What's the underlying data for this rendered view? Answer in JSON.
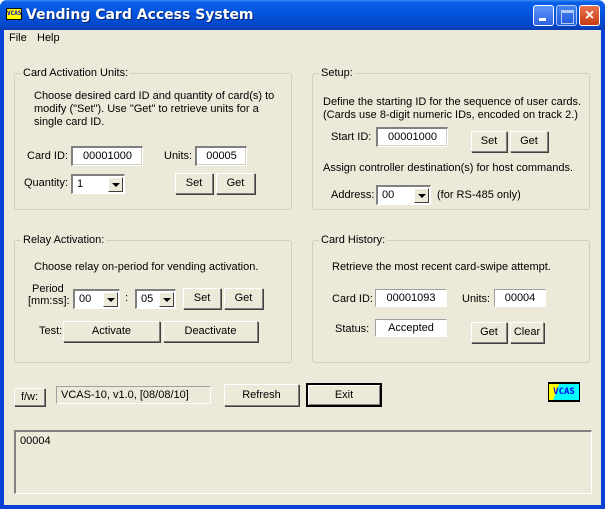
{
  "window": {
    "title": "Vending Card Access System",
    "icon_label": "VCAS",
    "controls": {
      "minimize": "minimize",
      "maximize": "maximize",
      "close": "×"
    }
  },
  "menu": [
    {
      "label": "File"
    },
    {
      "label": "Help"
    }
  ],
  "card_activation": {
    "title": "Card Activation Units:",
    "desc_line1": "Choose desired card ID and quantity of card(s) to",
    "desc_line2": "modify (\"Set\").  Use \"Get\" to retrieve units for a",
    "desc_line3": "single card ID.",
    "card_id_label": "Card ID:",
    "card_id_value": "00001000",
    "units_label": "Units:",
    "units_value": "00005",
    "quantity_label": "Quantity:",
    "quantity_value": "1",
    "set_label": "Set",
    "get_label": "Get"
  },
  "setup": {
    "title": "Setup:",
    "desc_line1": "Define the starting ID for the sequence of user cards.",
    "desc_line2": "(Cards use 8-digit numeric IDs, encoded on track 2.)",
    "start_id_label": "Start ID:",
    "start_id_value": "00001000",
    "set_label": "Set",
    "get_label": "Get",
    "assign_desc": "Assign controller destination(s) for host commands.",
    "address_label": "Address:",
    "address_value": "00",
    "address_note": "(for RS-485 only)"
  },
  "relay": {
    "title": "Relay Activation:",
    "desc": "Choose relay on-period for vending activation.",
    "period_label_1": "Period",
    "period_label_2": "[mm:ss]:",
    "minutes_value": "00",
    "separator": ":",
    "seconds_value": "05",
    "set_label": "Set",
    "get_label": "Get",
    "test_label": "Test:",
    "activate_label": "Activate",
    "deactivate_label": "Deactivate"
  },
  "history": {
    "title": "Card History:",
    "desc": "Retrieve the most recent card-swipe attempt.",
    "card_id_label": "Card ID:",
    "card_id_value": "00001093",
    "units_label": "Units:",
    "units_value": "00004",
    "status_label": "Status:",
    "status_value": "Accepted",
    "get_label": "Get",
    "clear_label": "Clear"
  },
  "footer": {
    "fw_button": "f/w:",
    "fw_version": "VCAS-10, v1.0, [08/08/10]",
    "refresh_label": "Refresh",
    "exit_label": "Exit",
    "logo_text": "VCAS"
  },
  "log": {
    "content": "00004"
  }
}
